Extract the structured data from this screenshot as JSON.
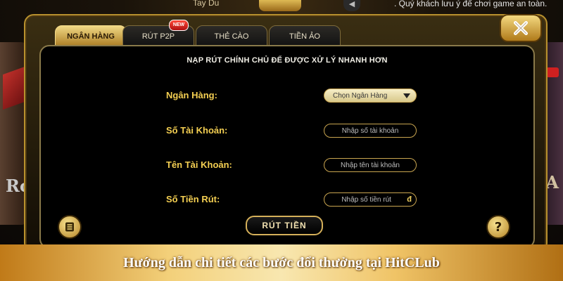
{
  "background": {
    "top_banner_label": "Tay Du",
    "ticker_text": ". Quý khách lưu ý để chơi game an toàn.",
    "left_side_text": "Ro",
    "right_side_text": "A"
  },
  "dialog": {
    "tabs": [
      {
        "label": "NGÂN HÀNG",
        "active": true
      },
      {
        "label": "RÚT P2P",
        "active": false
      },
      {
        "label": "THẺ CÀO",
        "active": false
      },
      {
        "label": "TIỀN ẢO",
        "active": false
      }
    ],
    "new_badge": "NEW",
    "panel_title": "NẠP RÚT CHÍNH CHỦ ĐỂ ĐƯỢC XỬ LÝ NHANH HƠN",
    "form": {
      "bank_label": "Ngân Hàng:",
      "bank_select_value": "Chọn Ngân Hàng",
      "account_number_label": "Số Tài Khoản:",
      "account_number_placeholder": "Nhập số tài  khoản",
      "account_name_label": "Tên Tài Khoản:",
      "account_name_placeholder": "Nhập tên tài khoản",
      "amount_label": "Số Tiền Rút:",
      "amount_placeholder": "Nhập số tiền rút",
      "currency_symbol": "đ"
    },
    "withdraw_button": "RÚT TIỀN",
    "help_button": "?"
  },
  "caption": "Hướng dẫn chi tiết các bước đổi thưởng tại HitCLub",
  "colors": {
    "accent_gold": "#f4cf52",
    "active_tab": "#f1d985",
    "panel_bg": "#000000"
  }
}
